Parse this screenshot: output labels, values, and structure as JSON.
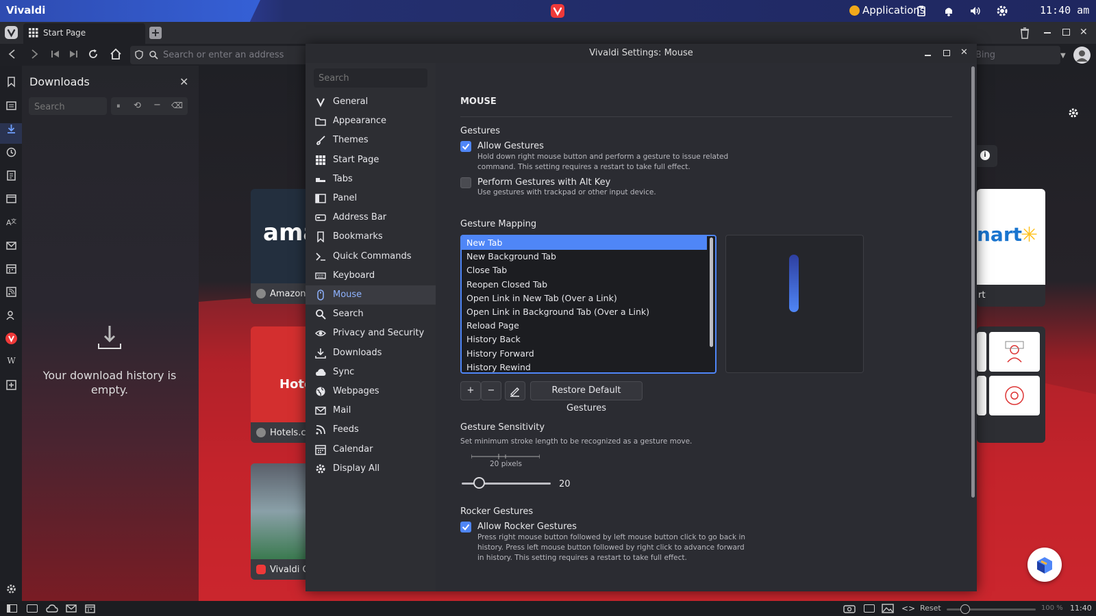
{
  "desktop": {
    "app_title": "Vivaldi",
    "applications_label": "Applications",
    "clock": "11:40 am"
  },
  "browser": {
    "tab_label": "Start Page",
    "address_placeholder": "Search or enter an address",
    "search_engine_placeholder": "Bing"
  },
  "downloads_panel": {
    "title": "Downloads",
    "search_placeholder": "Search",
    "empty_message": "Your download history is empty."
  },
  "speed_dial": {
    "tiles": [
      {
        "label": "Amazon",
        "logo_text": "ama"
      },
      {
        "label": "Hotels.co",
        "logo_text": "Hotel"
      },
      {
        "label": "Vivaldi G",
        "logo_text": ""
      },
      {
        "label": "rt",
        "logo_text": "nart"
      }
    ]
  },
  "settings": {
    "window_title": "Vivaldi Settings: Mouse",
    "search_placeholder": "Search",
    "nav": [
      {
        "label": "General",
        "icon": "vivaldi-logo-icon"
      },
      {
        "label": "Appearance",
        "icon": "folder-icon"
      },
      {
        "label": "Themes",
        "icon": "brush-icon"
      },
      {
        "label": "Start Page",
        "icon": "grid-icon"
      },
      {
        "label": "Tabs",
        "icon": "tabs-icon"
      },
      {
        "label": "Panel",
        "icon": "panel-icon"
      },
      {
        "label": "Address Bar",
        "icon": "address-bar-icon"
      },
      {
        "label": "Bookmarks",
        "icon": "bookmark-icon"
      },
      {
        "label": "Quick Commands",
        "icon": "terminal-icon"
      },
      {
        "label": "Keyboard",
        "icon": "keyboard-icon"
      },
      {
        "label": "Mouse",
        "icon": "mouse-icon"
      },
      {
        "label": "Search",
        "icon": "search-icon"
      },
      {
        "label": "Privacy and Security",
        "icon": "eye-icon"
      },
      {
        "label": "Downloads",
        "icon": "download-icon"
      },
      {
        "label": "Sync",
        "icon": "cloud-icon"
      },
      {
        "label": "Webpages",
        "icon": "globe-icon"
      },
      {
        "label": "Mail",
        "icon": "mail-icon"
      },
      {
        "label": "Feeds",
        "icon": "rss-icon"
      },
      {
        "label": "Calendar",
        "icon": "calendar-icon"
      },
      {
        "label": "Display All",
        "icon": "gear-icon"
      }
    ],
    "active_nav": "Mouse",
    "section_title": "MOUSE",
    "gestures": {
      "heading": "Gestures",
      "allow_label": "Allow Gestures",
      "allow_checked": true,
      "allow_desc": "Hold down right mouse button and perform a gesture to issue related command. This setting requires a restart to take full effect.",
      "alt_label": "Perform Gestures with Alt Key",
      "alt_checked": false,
      "alt_desc": "Use gestures with trackpad or other input device."
    },
    "mapping": {
      "heading": "Gesture Mapping",
      "items": [
        "New Tab",
        "New Background Tab",
        "Close Tab",
        "Reopen Closed Tab",
        "Open Link in New Tab (Over a Link)",
        "Open Link in Background Tab (Over a Link)",
        "Reload Page",
        "History Back",
        "History Forward",
        "History Rewind"
      ],
      "selected": "New Tab",
      "add_label": "+",
      "remove_label": "−",
      "restore_label": "Restore Default Gestures"
    },
    "sensitivity": {
      "heading": "Gesture Sensitivity",
      "desc": "Set minimum stroke length to be recognized as a gesture move.",
      "scale_label": "20 pixels",
      "value": "20"
    },
    "rocker": {
      "heading": "Rocker Gestures",
      "allow_label": "Allow Rocker Gestures",
      "allow_checked": true,
      "desc": "Press right mouse button followed by left mouse button click to go back in history. Press left mouse button followed by right click to advance forward in history. This setting requires a restart to take full effect."
    }
  },
  "statusbar": {
    "reset_label": "Reset",
    "zoom": "100 %",
    "time": "11:40"
  },
  "colors": {
    "accent": "#4f86f7",
    "vivaldi_red": "#ef3939"
  }
}
